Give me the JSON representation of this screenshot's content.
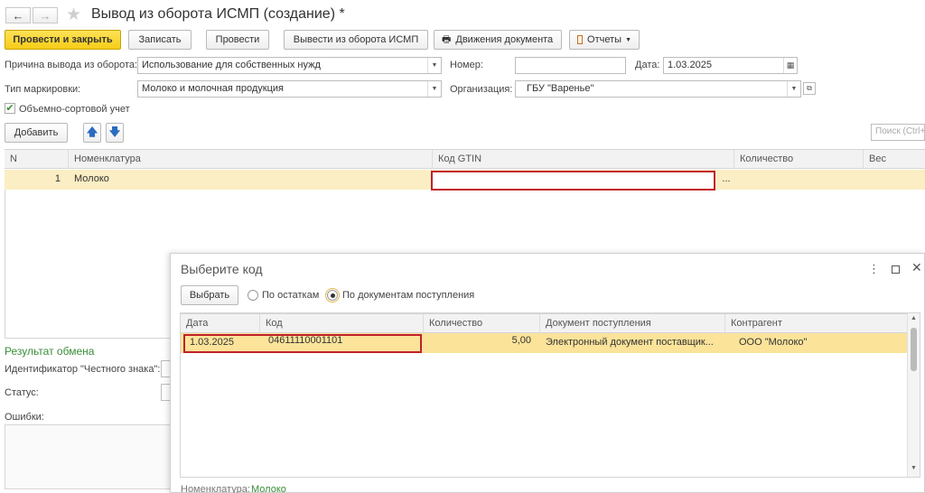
{
  "window": {
    "title": "Вывод из оборота ИСМП (создание) *"
  },
  "icons": {
    "back": "arrow-left-icon",
    "forward": "arrow-right-icon",
    "favorite": "star-icon",
    "print": "printer-icon",
    "reports": "report-icon",
    "calendar": "calendar-icon"
  },
  "toolbar": {
    "post_close": "Провести и закрыть",
    "save": "Записать",
    "post": "Провести",
    "withdraw": "Вывести из оборота ИСМП",
    "movements": "Движения документа",
    "reports": "Отчеты"
  },
  "form": {
    "reason_label": "Причина вывода из оборота:",
    "reason_value": "Использование для собственных нужд",
    "number_label": "Номер:",
    "number_value": "",
    "date_label": "Дата:",
    "date_value": "1.03.2025",
    "marking_label": "Тип маркировки:",
    "marking_value": "Молоко и молочная продукция",
    "org_label": "Организация:",
    "org_value": "ГБУ \"Варенье\"",
    "volume_checkbox_label": "Объемно-сортовой учет",
    "volume_checked": true
  },
  "table_toolbar": {
    "add": "Добавить",
    "search_placeholder": "Поиск (Ctrl+F)"
  },
  "table": {
    "headers": [
      "N",
      "Номенклатура",
      "Код GTIN",
      "Количество",
      "Вес"
    ],
    "rows": [
      {
        "n": "1",
        "nomenclature": "Молоко",
        "gtin": "",
        "qty": "",
        "weight": ""
      }
    ],
    "ellipsis": "..."
  },
  "exchange": {
    "title": "Результат обмена",
    "id_label": "Идентификатор \"Честного знака\":",
    "status_label": "Статус:",
    "errors_label": "Ошибки:"
  },
  "dialog": {
    "title": "Выберите код",
    "select_button": "Выбрать",
    "radio_balance": "По остаткам",
    "radio_docs": "По документам поступления",
    "selected_radio": "docs",
    "headers": [
      "Дата",
      "Код",
      "Количество",
      "Документ поступления",
      "Контрагент"
    ],
    "rows": [
      {
        "date": "1.03.2025",
        "code": "04611110001101",
        "qty": "5,00",
        "doc": "Электронный документ поставщик...",
        "contractor": "ООО \"Молоко\""
      }
    ],
    "footer_label": "Номенклатура:",
    "footer_value": "Молоко"
  },
  "colors": {
    "primary_button": "#f6cc16",
    "selected_row": "#fbeec4",
    "dialog_selected_row": "#fbe39a",
    "highlight_border": "#c0202a",
    "section_title": "#3a8d3a"
  }
}
